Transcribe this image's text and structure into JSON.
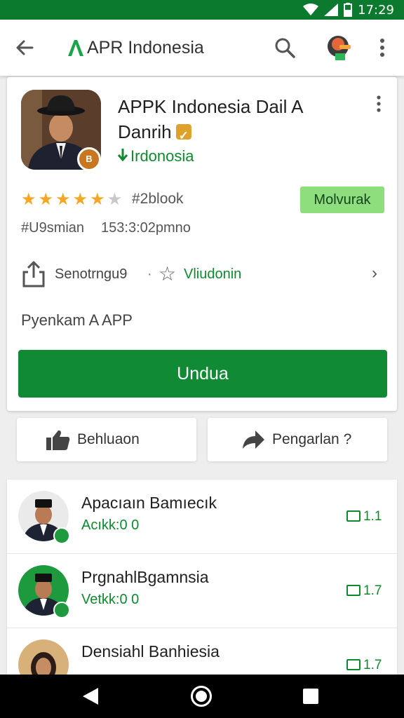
{
  "status_bar": {
    "time": "17:29",
    "icons": [
      "wifi-icon",
      "signal-icon",
      "battery-icon"
    ]
  },
  "app_bar": {
    "title": "APR Indonesia",
    "icons": [
      "back-arrow-icon",
      "search-icon",
      "account-avatar-icon",
      "more-vert-icon"
    ]
  },
  "app_card": {
    "name": "APPK Indonesia Dail A Danrih",
    "developer": "Irdonosia",
    "rating_stars": 4.5,
    "rating_count": "#2blook",
    "chip_label": "Molvurak",
    "version_label": "#U9smian",
    "version_value": "153:3:02pmno",
    "share_label": "Senotrngu9",
    "separator": "·",
    "wishlist_label": "Vliudonin",
    "category": "Pyenkam A APP",
    "install_label": "Undua"
  },
  "actions": {
    "left_label": "Behluaon",
    "right_label": "Pengarlan ?"
  },
  "list": {
    "items": [
      {
        "title": "Apacıaın Bamıecık",
        "subtitle": "Acıkk:0 0",
        "meta": "1.1"
      },
      {
        "title": "PrgnahlBgamnsia",
        "subtitle": "Vetkk:0 0",
        "meta": "1.7"
      },
      {
        "title": "Densiahl Banhiesia",
        "subtitle": "",
        "meta": "1.7"
      }
    ]
  },
  "colors": {
    "status_bar": "#0b7a2e",
    "accent": "#118a36",
    "chip": "#8fde7d",
    "star": "#f5a623"
  },
  "nav_bar": {
    "icons": [
      "nav-back-icon",
      "nav-home-icon",
      "nav-recents-icon"
    ]
  }
}
